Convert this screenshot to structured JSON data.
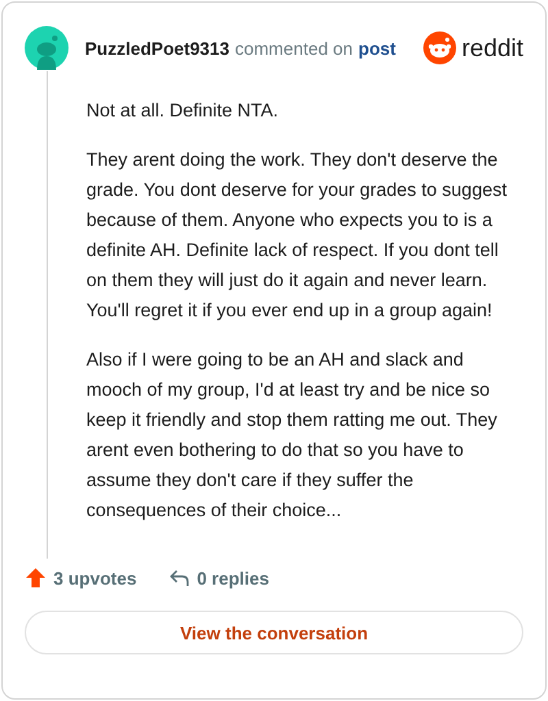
{
  "header": {
    "username": "PuzzledPoet9313",
    "action": "commented on",
    "link": "post",
    "logo": "reddit"
  },
  "paragraphs": [
    "Not at all. Definite NTA.",
    "They arent doing the work. They don't deserve the grade. You dont deserve for your grades to suggest because of them. Anyone who expects you to is a definite AH. Definite lack of respect. If you dont tell on them they will just do it again and never learn. You'll regret it if you ever end up in a group again!",
    "Also if I were going to be an AH and slack and mooch of my group, I'd at least try and be nice so keep it friendly and stop them ratting me out. They arent even bothering to do that so you have to assume they don't care if they suffer the consequences of their choice..."
  ],
  "stats": {
    "upvotes": "3 upvotes",
    "replies": "0 replies"
  },
  "button": "View the conversation"
}
